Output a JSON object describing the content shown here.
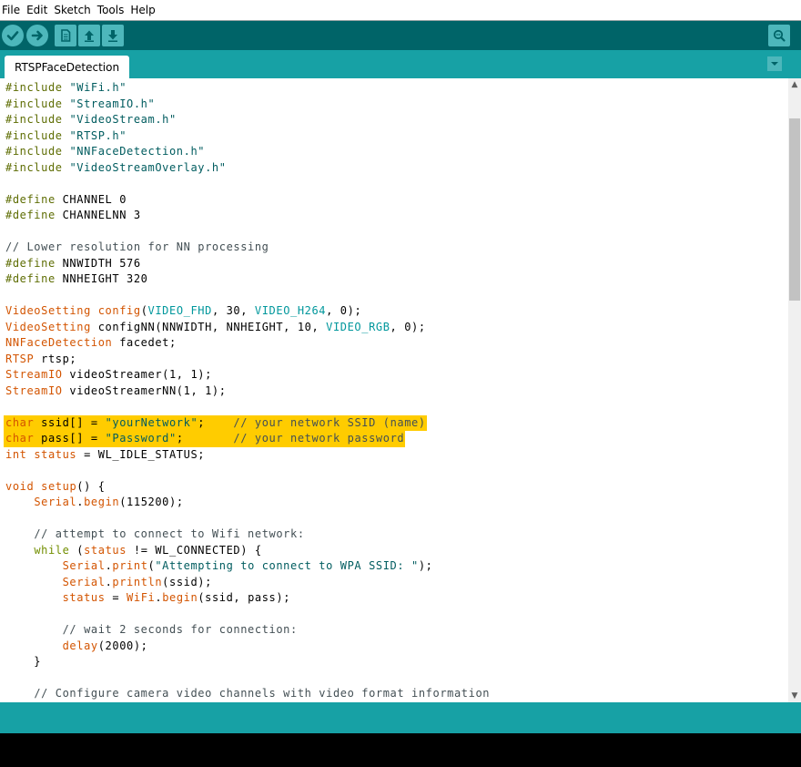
{
  "menu": [
    "File",
    "Edit",
    "Sketch",
    "Tools",
    "Help"
  ],
  "toolbar": {
    "buttons": [
      "verify-icon",
      "upload-icon",
      "new-icon",
      "open-icon",
      "save-icon"
    ],
    "serial_monitor": "serial-monitor-icon"
  },
  "tab": {
    "name": "RTSPFaceDetection"
  },
  "colors": {
    "toolbar": "#006468",
    "tabbar": "#17a1a5",
    "button": "#4db7bb",
    "highlight": "#ffcc00"
  },
  "code_lines": [
    "#include \"WiFi.h\"",
    "#include \"StreamIO.h\"",
    "#include \"VideoStream.h\"",
    "#include \"RTSP.h\"",
    "#include \"NNFaceDetection.h\"",
    "#include \"VideoStreamOverlay.h\"",
    "",
    "#define CHANNEL 0",
    "#define CHANNELNN 3",
    "",
    "// Lower resolution for NN processing",
    "#define NNWIDTH 576",
    "#define NNHEIGHT 320",
    "",
    "VideoSetting config(VIDEO_FHD, 30, VIDEO_H264, 0);",
    "VideoSetting configNN(NNWIDTH, NNHEIGHT, 10, VIDEO_RGB, 0);",
    "NNFaceDetection facedet;",
    "RTSP rtsp;",
    "StreamIO videoStreamer(1, 1);",
    "StreamIO videoStreamerNN(1, 1);",
    "",
    "char ssid[] = \"yourNetwork\";    // your network SSID (name)",
    "char pass[] = \"Password\";       // your network password",
    "int status = WL_IDLE_STATUS;",
    "",
    "void setup() {",
    "    Serial.begin(115200);",
    "",
    "    // attempt to connect to Wifi network:",
    "    while (status != WL_CONNECTED) {",
    "        Serial.print(\"Attempting to connect to WPA SSID: \");",
    "        Serial.println(ssid);",
    "        status = WiFi.begin(ssid, pass);",
    "",
    "        // wait 2 seconds for connection:",
    "        delay(2000);",
    "    }",
    "",
    "    // Configure camera video channels with video format information"
  ],
  "highlighted_lines": [
    21,
    22
  ]
}
